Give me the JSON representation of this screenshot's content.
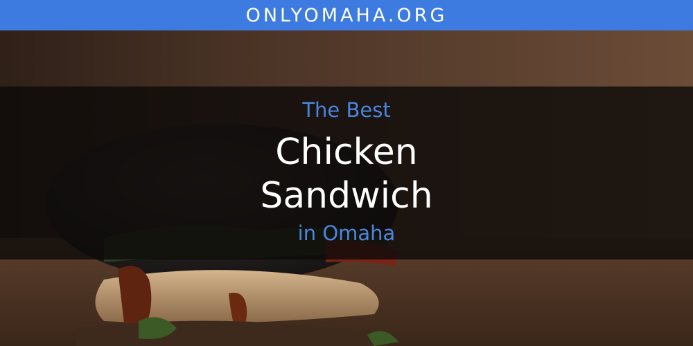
{
  "site": {
    "name": "ONLYOMAHA.ORG",
    "banner_color": "#3d7be0"
  },
  "headline": {
    "pre_title": "The Best",
    "title_line1": "Chicken",
    "title_line2": "Sandwich",
    "post_title": "in Omaha",
    "accent_color": "#4a85e0",
    "title_color": "#ffffff"
  },
  "background": {
    "image_subject": "chicken-sandwich-photo"
  }
}
